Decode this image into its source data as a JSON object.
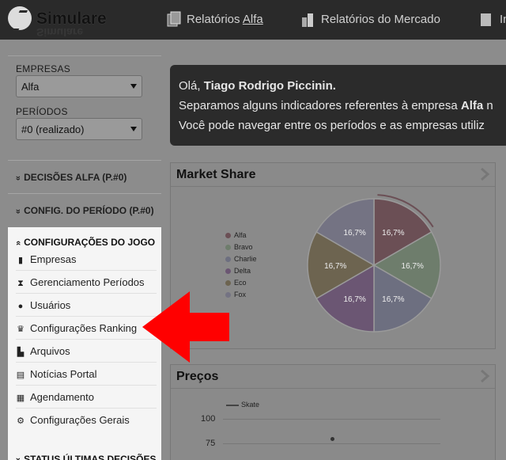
{
  "app": {
    "brand": "Simulare"
  },
  "nav": {
    "items": [
      {
        "label_pre": "Relatórios ",
        "label_link": "Alfa",
        "icon": "reports-icon"
      },
      {
        "label": "Relatórios do Mercado",
        "icon": "market-icon"
      },
      {
        "label": "In",
        "icon": "more-icon"
      }
    ]
  },
  "sidebar": {
    "empresas_label": "EMPRESAS",
    "empresas_value": "Alfa",
    "periodos_label": "PERÍODOS",
    "periodos_value": "#0 (realizado)",
    "sections": [
      {
        "label": "DECISÕES ALFA (P.#0)",
        "chevron": "«"
      },
      {
        "label": "CONFIG. DO PERÍODO (P.#0)",
        "chevron": "«"
      }
    ],
    "config": {
      "header": "CONFIGURAÇÕES DO JOGO",
      "items": [
        {
          "label": "Empresas",
          "icon": "building-icon"
        },
        {
          "label": "Gerenciamento Períodos",
          "icon": "hourglass-icon"
        },
        {
          "label": "Usuários",
          "icon": "users-icon"
        },
        {
          "label": "Configurações Ranking",
          "icon": "trophy-icon"
        },
        {
          "label": "Arquivos",
          "icon": "file-icon"
        },
        {
          "label": "Notícias Portal",
          "icon": "newspaper-icon"
        },
        {
          "label": "Agendamento",
          "icon": "calendar-icon"
        },
        {
          "label": "Configurações Gerais",
          "icon": "cogs-icon"
        }
      ]
    },
    "footer_section": "STATUS ÚLTIMAS DECISÕES"
  },
  "welcome": {
    "line1_pre": "Olá, ",
    "user": "Tiago Rodrigo Piccinin.",
    "line2_pre": "Separamos alguns indicadores referentes à empresa ",
    "line2_company": "Alfa",
    "line2_post": " n",
    "line3": "Você pode navegar entre os períodos e as empresas utiliz"
  },
  "market_share": {
    "title": "Market Share",
    "legend": [
      "Alfa",
      "Bravo",
      "Charlie",
      "Delta",
      "Eco",
      "Fox"
    ],
    "colors": [
      "#6b4f55",
      "#6e7d6c",
      "#6d6f80",
      "#6b5673",
      "#6d6450",
      "#747383"
    ]
  },
  "chart_data": [
    {
      "type": "pie",
      "title": "Market Share",
      "categories": [
        "Alfa",
        "Charlie",
        "Bravo",
        "Delta",
        "Eco",
        "Fox"
      ],
      "values": [
        16.7,
        16.7,
        16.7,
        16.7,
        16.7,
        16.7
      ],
      "data_labels": [
        "16,7%",
        "16,7%",
        "16,7%",
        "16,7%",
        "16,7%",
        "16,7%"
      ],
      "legend": "left"
    },
    {
      "type": "line",
      "title": "Preços",
      "series": [
        {
          "name": "Skate",
          "values": [
            80
          ]
        }
      ],
      "ytick_labels": [
        "100",
        "75"
      ]
    }
  ],
  "precos": {
    "title": "Preços",
    "legend": "Skate",
    "ticks": [
      "100",
      "75"
    ]
  },
  "arrow_color": "#ff0000"
}
